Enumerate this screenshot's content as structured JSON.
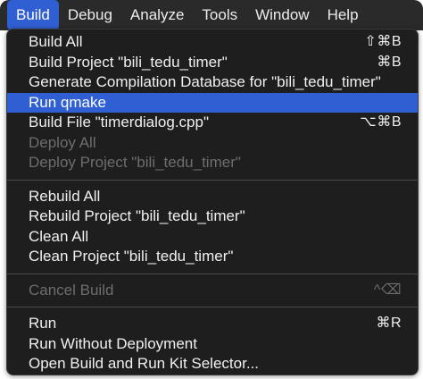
{
  "menubar": {
    "items": [
      {
        "label": "Build"
      },
      {
        "label": "Debug"
      },
      {
        "label": "Analyze"
      },
      {
        "label": "Tools"
      },
      {
        "label": "Window"
      },
      {
        "label": "Help"
      }
    ]
  },
  "menu": {
    "group1": [
      {
        "label": "Build All",
        "shortcut": "⇧⌘B"
      },
      {
        "label": "Build Project \"bili_tedu_timer\"",
        "shortcut": "⌘B"
      },
      {
        "label": "Generate Compilation Database for \"bili_tedu_timer\"",
        "shortcut": ""
      },
      {
        "label": "Run qmake",
        "shortcut": ""
      },
      {
        "label": "Build File \"timerdialog.cpp\"",
        "shortcut": "⌥⌘B"
      },
      {
        "label": "Deploy All",
        "shortcut": ""
      },
      {
        "label": "Deploy Project \"bili_tedu_timer\"",
        "shortcut": ""
      }
    ],
    "group2": [
      {
        "label": "Rebuild All"
      },
      {
        "label": "Rebuild Project \"bili_tedu_timer\""
      },
      {
        "label": "Clean All"
      },
      {
        "label": "Clean Project \"bili_tedu_timer\""
      }
    ],
    "group3": [
      {
        "label": "Cancel Build",
        "shortcut": "^⌫"
      }
    ],
    "group4": [
      {
        "label": "Run",
        "shortcut": "⌘R"
      },
      {
        "label": "Run Without Deployment",
        "shortcut": ""
      },
      {
        "label": "Open Build and Run Kit Selector...",
        "shortcut": ""
      }
    ]
  },
  "colors": {
    "highlight": "#2f5fd2",
    "menu_background": "#1e1e1e",
    "disabled_text": "#6d6d6d"
  }
}
